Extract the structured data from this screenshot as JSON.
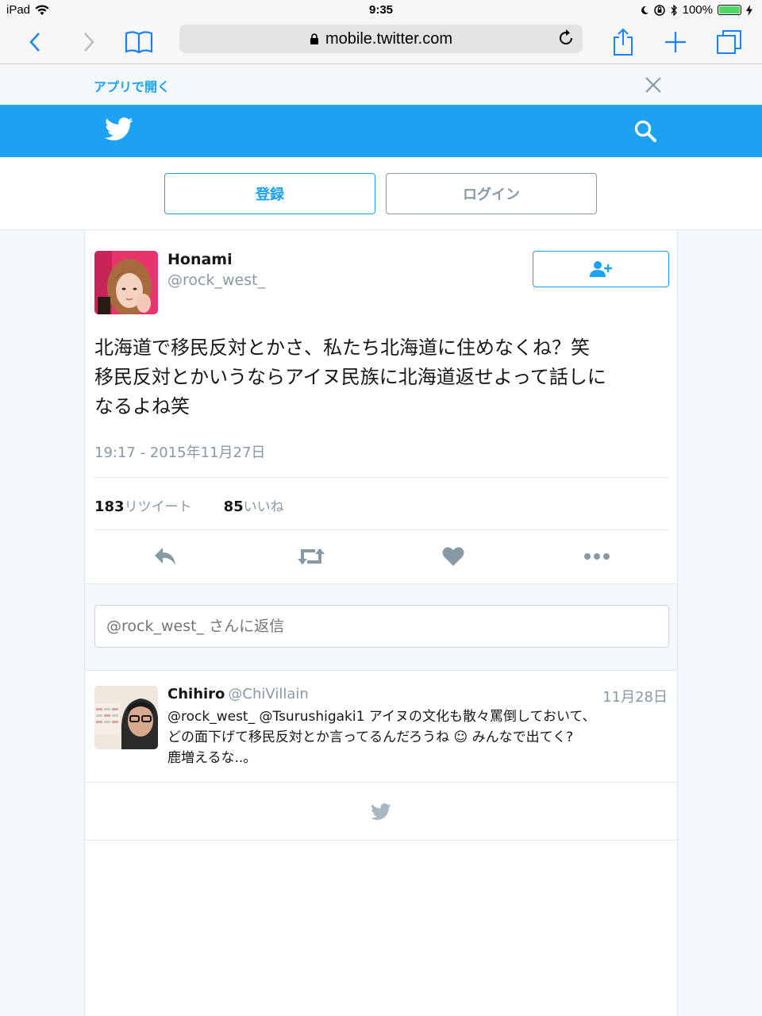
{
  "status_bar": {
    "device": "iPad",
    "time": "9:35",
    "battery": "100%",
    "battery_level": 1.0
  },
  "browser": {
    "url": "mobile.twitter.com",
    "icons": [
      "back-icon",
      "forward-icon",
      "bookmarks-icon",
      "lock-icon",
      "reload-icon",
      "share-icon",
      "new-tab-icon",
      "tabs-icon"
    ]
  },
  "app_banner": {
    "open_in_app": "アプリで開く"
  },
  "header": {
    "icons": [
      "twitter-bird-icon",
      "search-icon"
    ],
    "brand_color": "#1da1f2"
  },
  "auth": {
    "signup_label": "登録",
    "login_label": "ログイン"
  },
  "tweet": {
    "name": "Honami",
    "handle": "@rock_west_",
    "text_lines": [
      "北海道で移民反対とかさ、私たち北海道に住めなくね？笑",
      "移民反対とかいうならアイヌ民族に北海道返せよって話しに",
      "なるよね笑"
    ],
    "timestamp": "19:17 - 2015年11月27日",
    "retweets_count": "183",
    "retweets_label": "リツイート",
    "likes_count": "85",
    "likes_label": "いいね"
  },
  "reply_box": {
    "placeholder": "@rock_west_ さんに返信"
  },
  "reply": {
    "name": "Chihiro",
    "handle": "@ChiVillain",
    "date": "11月28日",
    "text_lines": [
      "@rock_west_ @Tsurushigaki1 アイヌの文化も散々罵倒しておいて、",
      "どの面下げて移民反対とか言ってるんだろうね ☺ みんなで出てく?",
      "鹿増えるな..。"
    ]
  }
}
